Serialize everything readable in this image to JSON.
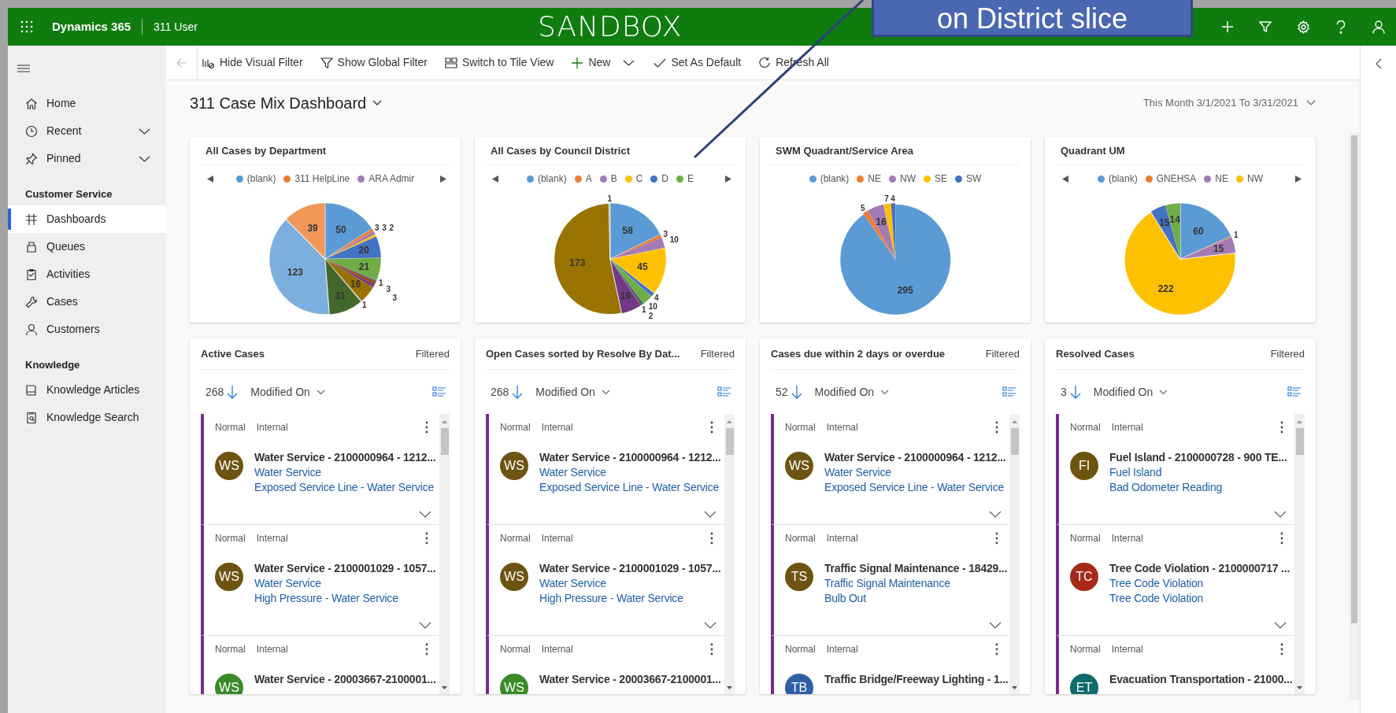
{
  "header": {
    "app_name": "Dynamics 365",
    "area": "311 User",
    "environment": "SANDBOX"
  },
  "callout": {
    "text": "on District slice"
  },
  "toolbar": {
    "buttons": [
      {
        "label": "Hide Visual Filter",
        "dropdown": false
      },
      {
        "label": "Show Global Filter",
        "dropdown": false
      },
      {
        "label": "Switch to Tile View",
        "dropdown": false
      },
      {
        "label": "New",
        "dropdown": true
      },
      {
        "label": "Set As Default",
        "dropdown": false
      },
      {
        "label": "Refresh All",
        "dropdown": false
      }
    ]
  },
  "sidebar": {
    "top_items": [
      {
        "label": "Home",
        "expandable": false,
        "selected": false
      },
      {
        "label": "Recent",
        "expandable": true,
        "selected": false
      },
      {
        "label": "Pinned",
        "expandable": true,
        "selected": false
      }
    ],
    "sections": [
      {
        "title": "Customer Service",
        "items": [
          {
            "label": "Dashboards",
            "selected": true
          },
          {
            "label": "Queues",
            "selected": false
          },
          {
            "label": "Activities",
            "selected": false
          },
          {
            "label": "Cases",
            "selected": false
          },
          {
            "label": "Customers",
            "selected": false
          }
        ]
      },
      {
        "title": "Knowledge",
        "items": [
          {
            "label": "Knowledge Articles",
            "selected": false
          },
          {
            "label": "Knowledge Search",
            "selected": false
          }
        ]
      }
    ]
  },
  "dashboard": {
    "title": "311 Case Mix Dashboard",
    "date_range": "This Month 3/1/2021 To 3/31/2021"
  },
  "charts": [
    {
      "title": "All Cases by Department",
      "legend_paging": true,
      "legend": [
        {
          "label": "(blank)",
          "color": "#5b9bd5"
        },
        {
          "label": "311 HelpLine",
          "color": "#ed7d31"
        },
        {
          "label": "ARA Admir",
          "color": "#a27bb5"
        }
      ],
      "chart_data": {
        "type": "pie",
        "data_labels": true,
        "values": [
          50,
          3,
          3,
          2,
          20,
          21,
          1,
          3,
          3,
          16,
          1,
          31,
          123,
          39
        ],
        "colors": [
          "#5b9bd5",
          "#ed7d31",
          "#a27bb5",
          "#ffc000",
          "#4472c4",
          "#70ad47",
          "#255e91",
          "#9e480e",
          "#6f3a87",
          "#997300",
          "#bfbfbf",
          "#43682b",
          "#7cafdd",
          "#f1975a"
        ]
      }
    },
    {
      "title": "All Cases by Council District",
      "legend_paging": true,
      "legend": [
        {
          "label": "(blank)",
          "color": "#5b9bd5"
        },
        {
          "label": "A",
          "color": "#ed7d31"
        },
        {
          "label": "B",
          "color": "#a27bb5"
        },
        {
          "label": "C",
          "color": "#ffc000"
        },
        {
          "label": "D",
          "color": "#4472c4"
        },
        {
          "label": "E",
          "color": "#70ad47"
        }
      ],
      "chart_data": {
        "type": "pie",
        "data_labels": true,
        "values": [
          58,
          3,
          10,
          45,
          4,
          10,
          2,
          1,
          19,
          173,
          1
        ],
        "colors": [
          "#5b9bd5",
          "#ed7d31",
          "#a27bb5",
          "#ffc000",
          "#4472c4",
          "#70ad47",
          "#255e91",
          "#9e480e",
          "#6f3a87",
          "#997300",
          "#bfbfbf"
        ]
      }
    },
    {
      "title": "SWM Quadrant/Service Area",
      "legend_paging": false,
      "legend": [
        {
          "label": "(blank)",
          "color": "#5b9bd5"
        },
        {
          "label": "NE",
          "color": "#ed7d31"
        },
        {
          "label": "NW",
          "color": "#a27bb5"
        },
        {
          "label": "SE",
          "color": "#ffc000"
        },
        {
          "label": "SW",
          "color": "#4472c4"
        }
      ],
      "chart_data": {
        "type": "pie",
        "data_labels": true,
        "values": [
          295,
          5,
          16,
          7,
          4
        ],
        "colors": [
          "#5b9bd5",
          "#ed7d31",
          "#a27bb5",
          "#ffc000",
          "#4472c4"
        ]
      }
    },
    {
      "title": "Quadrant UM",
      "legend_paging": true,
      "legend": [
        {
          "label": "(blank)",
          "color": "#5b9bd5"
        },
        {
          "label": "GNEHSA",
          "color": "#ed7d31"
        },
        {
          "label": "NE",
          "color": "#a27bb5"
        },
        {
          "label": "NW",
          "color": "#ffc000"
        }
      ],
      "chart_data": {
        "type": "pie",
        "data_labels": true,
        "values": [
          60,
          1,
          15,
          222,
          15,
          14
        ],
        "colors": [
          "#5b9bd5",
          "#ed7d31",
          "#a27bb5",
          "#ffc000",
          "#4472c4",
          "#70ad47"
        ]
      }
    }
  ],
  "streams": [
    {
      "title": "Active Cases",
      "filter_label": "Filtered",
      "count": "268",
      "sort_field": "Modified On",
      "items": [
        {
          "priority": "Normal",
          "type": "Internal",
          "initials": "WS",
          "color": "#6d5411",
          "title": "Water Service - 2100000964 - 1212...",
          "lines": [
            "Water Service",
            "Exposed Service Line - Water Service"
          ]
        },
        {
          "priority": "Normal",
          "type": "Internal",
          "initials": "WS",
          "color": "#6d5411",
          "title": "Water Service - 2100001029 - 1057...",
          "lines": [
            "Water Service",
            "High Pressure - Water Service"
          ]
        },
        {
          "priority": "Normal",
          "type": "Internal",
          "initials": "WS",
          "color": "#3a8a28",
          "title": "Water Service - 20003667-2100001..."
        }
      ]
    },
    {
      "title": "Open Cases sorted by Resolve By Dat...",
      "filter_label": "Filtered",
      "count": "268",
      "sort_field": "Modified On",
      "items": [
        {
          "priority": "Normal",
          "type": "Internal",
          "initials": "WS",
          "color": "#6d5411",
          "title": "Water Service - 2100000964 - 1212...",
          "lines": [
            "Water Service",
            "Exposed Service Line - Water Service"
          ]
        },
        {
          "priority": "Normal",
          "type": "Internal",
          "initials": "WS",
          "color": "#6d5411",
          "title": "Water Service - 2100001029 - 1057...",
          "lines": [
            "Water Service",
            "High Pressure - Water Service"
          ]
        },
        {
          "priority": "Normal",
          "type": "Internal",
          "initials": "WS",
          "color": "#3a8a28",
          "title": "Water Service - 20003667-2100001..."
        }
      ]
    },
    {
      "title": "Cases due within 2 days or overdue",
      "filter_label": "Filtered",
      "count": "52",
      "sort_field": "Modified On",
      "items": [
        {
          "priority": "Normal",
          "type": "Internal",
          "initials": "WS",
          "color": "#6d5411",
          "title": "Water Service - 2100000964 - 1212...",
          "lines": [
            "Water Service",
            "Exposed Service Line - Water Service"
          ]
        },
        {
          "priority": "Normal",
          "type": "Internal",
          "initials": "TS",
          "color": "#6d5411",
          "title": "Traffic Signal Maintenance - 18429...",
          "lines": [
            "Traffic Signal Maintenance",
            "Bulb Out"
          ]
        },
        {
          "priority": "Normal",
          "type": "Internal",
          "initials": "TB",
          "color": "#2f5fa5",
          "title": "Traffic Bridge/Freeway Lighting - 1..."
        }
      ]
    },
    {
      "title": "Resolved Cases",
      "filter_label": "Filtered",
      "count": "3",
      "sort_field": "Modified On",
      "items": [
        {
          "priority": "Normal",
          "type": "Internal",
          "initials": "FI",
          "color": "#6d5411",
          "title": "Fuel Island - 2100000728 - 900 TE...",
          "lines": [
            "Fuel Island",
            "Bad Odometer Reading"
          ]
        },
        {
          "priority": "Normal",
          "type": "Internal",
          "initials": "TC",
          "color": "#a52a1a",
          "title": "Tree Code Violation - 2100000717 ...",
          "lines": [
            "Tree Code Violation",
            "Tree Code Violation"
          ]
        },
        {
          "priority": "Normal",
          "type": "Internal",
          "initials": "ET",
          "color": "#0f6b6b",
          "title": "Evacuation Transportation - 21000..."
        }
      ]
    }
  ]
}
